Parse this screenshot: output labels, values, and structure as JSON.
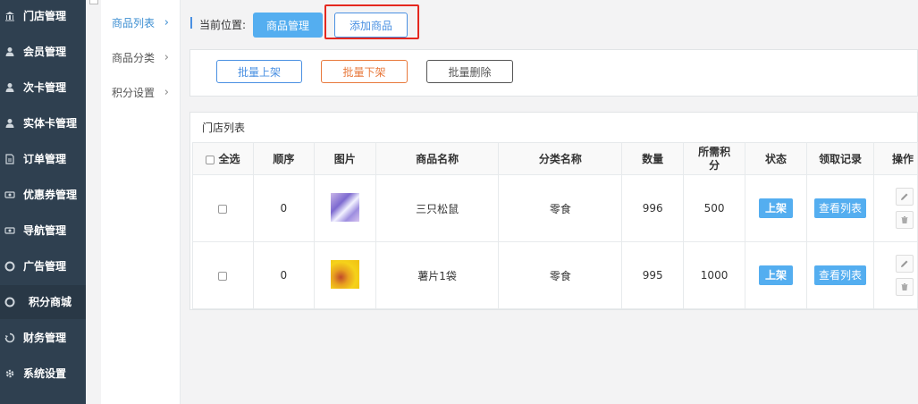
{
  "sidebar": {
    "items": [
      {
        "label": "门店管理",
        "icon": "bank-icon"
      },
      {
        "label": "会员管理",
        "icon": "user-icon"
      },
      {
        "label": "次卡管理",
        "icon": "user-icon"
      },
      {
        "label": "实体卡管理",
        "icon": "user-icon"
      },
      {
        "label": "订单管理",
        "icon": "document-icon"
      },
      {
        "label": "优惠券管理",
        "icon": "ticket-icon"
      },
      {
        "label": "导航管理",
        "icon": "ticket-icon"
      },
      {
        "label": "广告管理",
        "icon": "lifebuoy-icon"
      },
      {
        "label": "积分商城",
        "icon": "lifebuoy-icon"
      },
      {
        "label": "财务管理",
        "icon": "recycle-icon"
      },
      {
        "label": "系统设置",
        "icon": "gear-icon"
      }
    ]
  },
  "subnav": {
    "items": [
      {
        "label": "商品列表"
      },
      {
        "label": "商品分类"
      },
      {
        "label": "积分设置"
      }
    ]
  },
  "breadcrumb": {
    "label": "当前位置:",
    "current": "商品管理",
    "add_button": "添加商品"
  },
  "actions": {
    "up": "批量上架",
    "down": "批量下架",
    "delete": "批量删除"
  },
  "table": {
    "title": "门店列表",
    "headers": [
      "全选",
      "顺序",
      "图片",
      "商品名称",
      "分类名称",
      "数量",
      "所需积分",
      "状态",
      "领取记录",
      "操作"
    ],
    "rows": [
      {
        "order": "0",
        "name": "三只松鼠",
        "category": "零食",
        "qty": "996",
        "points": "500",
        "status": "上架",
        "records": "查看列表"
      },
      {
        "order": "0",
        "name": "薯片1袋",
        "category": "零食",
        "qty": "995",
        "points": "1000",
        "status": "上架",
        "records": "查看列表"
      }
    ]
  },
  "colors": {
    "sidebar_bg": "#2f4050",
    "primary": "#54aef0",
    "highlight": "#e5281f",
    "down": "#e8793c"
  }
}
